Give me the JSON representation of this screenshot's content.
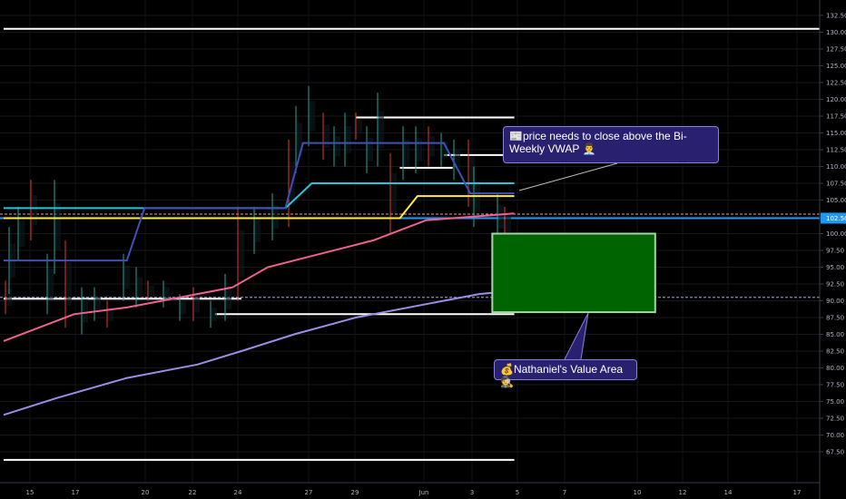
{
  "chart_data": {
    "type": "line",
    "y_ticks": [
      "132.50",
      "130.00",
      "127.50",
      "125.00",
      "122.50",
      "120.00",
      "117.50",
      "115.00",
      "112.50",
      "110.00",
      "107.50",
      "105.00",
      "102.50",
      "100.00",
      "97.50",
      "95.00",
      "92.50",
      "90.00",
      "87.50",
      "85.00",
      "82.50",
      "80.00",
      "77.50",
      "75.00",
      "72.50",
      "70.00",
      "67.50"
    ],
    "x_ticks": [
      "15",
      "17",
      "20",
      "22",
      "24",
      "27",
      "29",
      "Jun",
      "3",
      "5",
      "7",
      "10",
      "12",
      "14",
      "17"
    ],
    "ylim": [
      66,
      134
    ],
    "grid": true,
    "current_price": "102.50",
    "series": [
      {
        "color": "#f06292",
        "points": [
          [
            0,
            84
          ],
          [
            8,
            88
          ],
          [
            14,
            89
          ],
          [
            22,
            91
          ],
          [
            26,
            92
          ],
          [
            30,
            95
          ],
          [
            36,
            97
          ],
          [
            42,
            99
          ],
          [
            48,
            102
          ],
          [
            56,
            102.8
          ],
          [
            58,
            103
          ]
        ]
      },
      {
        "color": "#9c8ee6",
        "points": [
          [
            0,
            73
          ],
          [
            6,
            75.5
          ],
          [
            10,
            77
          ],
          [
            14,
            78.5
          ],
          [
            18,
            79.5
          ],
          [
            22,
            80.5
          ],
          [
            27,
            82.5
          ],
          [
            33,
            85
          ],
          [
            40,
            87.5
          ],
          [
            48,
            89.5
          ],
          [
            54,
            91
          ],
          [
            58,
            91.5
          ]
        ]
      },
      {
        "color": "#26c6da",
        "points": [
          [
            0,
            103.8
          ],
          [
            32,
            103.8
          ],
          [
            35,
            107.5
          ],
          [
            58,
            107.5
          ]
        ]
      },
      {
        "color": "#ffeb3b",
        "points": [
          [
            0,
            102.3
          ],
          [
            45,
            102.3
          ],
          [
            47,
            105.6
          ],
          [
            58,
            105.6
          ]
        ]
      },
      {
        "color": "#3f51b5",
        "points": [
          [
            0,
            96
          ],
          [
            14,
            96
          ],
          [
            16,
            103.8
          ],
          [
            32,
            103.8
          ],
          [
            34,
            113.5
          ],
          [
            50,
            113.5
          ],
          [
            53,
            106
          ],
          [
            58,
            106
          ]
        ]
      }
    ],
    "levels": [
      {
        "value": 130.5,
        "x0": 0,
        "x1": 94
      },
      {
        "value": 117.3,
        "x0": 40,
        "x1": 58
      },
      {
        "value": 111.7,
        "x0": 50,
        "x1": 58
      },
      {
        "value": 109.8,
        "x0": 45,
        "x1": 51
      },
      {
        "value": 88.0,
        "x0": 24,
        "x1": 58
      },
      {
        "value": 90.3,
        "x0": 0,
        "x1": 27
      },
      {
        "value": 66.3,
        "x0": 0,
        "x1": 58
      }
    ],
    "value_area": {
      "low": 88.3,
      "high": 100.0,
      "x0": 55.5,
      "x1": 74
    },
    "annotations": [
      {
        "text": "📰price needs to close above the Bi-Weekly VWAP 👨‍💼"
      },
      {
        "text": "💰Nathaniel's Value Area🕵"
      }
    ]
  }
}
